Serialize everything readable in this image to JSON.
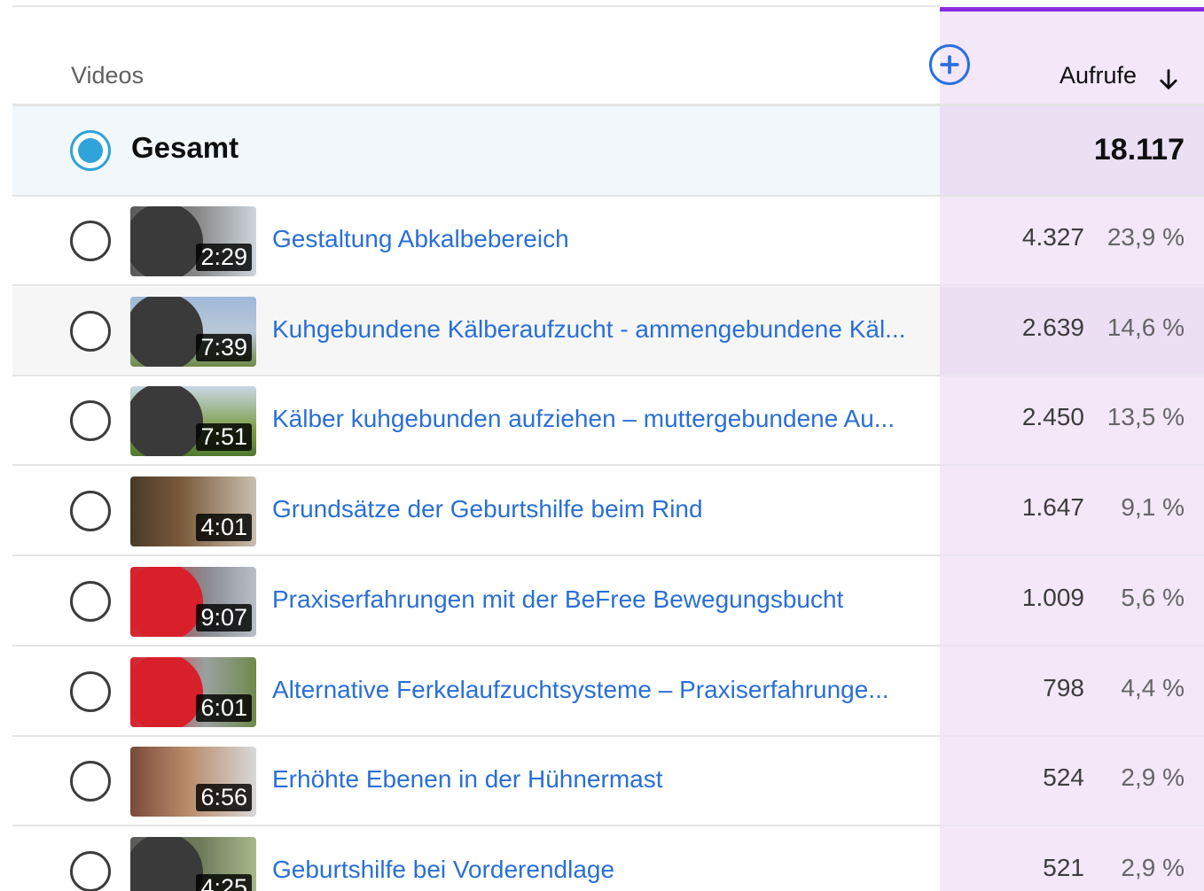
{
  "header": {
    "column_label": "Videos",
    "add_column_icon": "plus-circle-icon",
    "sort_label": "Aufrufe",
    "sort_icon": "arrow-down-icon"
  },
  "colors": {
    "link": "#2a6fd6",
    "accent": "#8a2be2",
    "radio_selected": "#2fa3da",
    "metric_column": "#f3e7f8"
  },
  "total": {
    "label": "Gesamt",
    "value": "18.117",
    "selected": true
  },
  "rows": [
    {
      "title": "Gestaltung Abkalbebereich",
      "duration": "2:29",
      "views": "4.327",
      "percent": "23,9 %"
    },
    {
      "title": "Kuhgebundene Kälberaufzucht - ammengebundene Käl...",
      "duration": "7:39",
      "views": "2.639",
      "percent": "14,6 %"
    },
    {
      "title": "Kälber kuhgebunden aufziehen – muttergebundene Au...",
      "duration": "7:51",
      "views": "2.450",
      "percent": "13,5 %"
    },
    {
      "title": "Grundsätze der Geburtshilfe beim Rind",
      "duration": "4:01",
      "views": "1.647",
      "percent": "9,1 %"
    },
    {
      "title": "Praxiserfahrungen mit der BeFree Bewegungsbucht",
      "duration": "9:07",
      "views": "1.009",
      "percent": "5,6 %"
    },
    {
      "title": "Alternative Ferkelaufzuchtsysteme – Praxiserfahrunge...",
      "duration": "6:01",
      "views": "798",
      "percent": "4,4 %"
    },
    {
      "title": "Erhöhte Ebenen in der Hühnermast",
      "duration": "6:56",
      "views": "524",
      "percent": "2,9 %"
    },
    {
      "title": "Geburtshilfe bei Vorderendlage",
      "duration": "4:25",
      "views": "521",
      "percent": "2,9 %"
    }
  ]
}
